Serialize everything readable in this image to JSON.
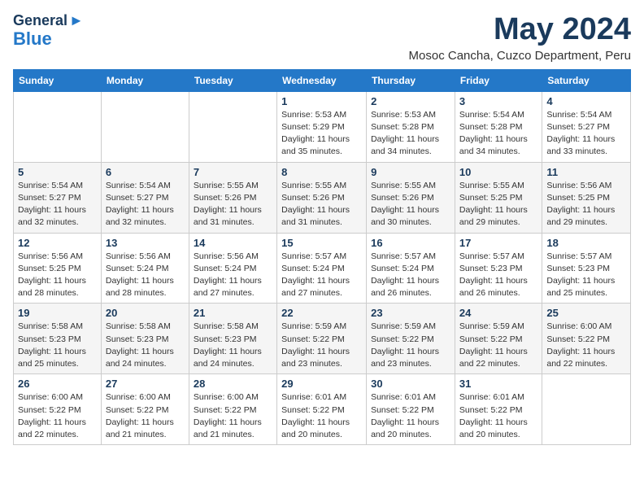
{
  "header": {
    "logo_line1": "General",
    "logo_line2": "Blue",
    "month": "May 2024",
    "location": "Mosoc Cancha, Cuzco Department, Peru"
  },
  "weekdays": [
    "Sunday",
    "Monday",
    "Tuesday",
    "Wednesday",
    "Thursday",
    "Friday",
    "Saturday"
  ],
  "weeks": [
    [
      {
        "day": "",
        "detail": ""
      },
      {
        "day": "",
        "detail": ""
      },
      {
        "day": "",
        "detail": ""
      },
      {
        "day": "1",
        "detail": "Sunrise: 5:53 AM\nSunset: 5:29 PM\nDaylight: 11 hours\nand 35 minutes."
      },
      {
        "day": "2",
        "detail": "Sunrise: 5:53 AM\nSunset: 5:28 PM\nDaylight: 11 hours\nand 34 minutes."
      },
      {
        "day": "3",
        "detail": "Sunrise: 5:54 AM\nSunset: 5:28 PM\nDaylight: 11 hours\nand 34 minutes."
      },
      {
        "day": "4",
        "detail": "Sunrise: 5:54 AM\nSunset: 5:27 PM\nDaylight: 11 hours\nand 33 minutes."
      }
    ],
    [
      {
        "day": "5",
        "detail": "Sunrise: 5:54 AM\nSunset: 5:27 PM\nDaylight: 11 hours\nand 32 minutes."
      },
      {
        "day": "6",
        "detail": "Sunrise: 5:54 AM\nSunset: 5:27 PM\nDaylight: 11 hours\nand 32 minutes."
      },
      {
        "day": "7",
        "detail": "Sunrise: 5:55 AM\nSunset: 5:26 PM\nDaylight: 11 hours\nand 31 minutes."
      },
      {
        "day": "8",
        "detail": "Sunrise: 5:55 AM\nSunset: 5:26 PM\nDaylight: 11 hours\nand 31 minutes."
      },
      {
        "day": "9",
        "detail": "Sunrise: 5:55 AM\nSunset: 5:26 PM\nDaylight: 11 hours\nand 30 minutes."
      },
      {
        "day": "10",
        "detail": "Sunrise: 5:55 AM\nSunset: 5:25 PM\nDaylight: 11 hours\nand 29 minutes."
      },
      {
        "day": "11",
        "detail": "Sunrise: 5:56 AM\nSunset: 5:25 PM\nDaylight: 11 hours\nand 29 minutes."
      }
    ],
    [
      {
        "day": "12",
        "detail": "Sunrise: 5:56 AM\nSunset: 5:25 PM\nDaylight: 11 hours\nand 28 minutes."
      },
      {
        "day": "13",
        "detail": "Sunrise: 5:56 AM\nSunset: 5:24 PM\nDaylight: 11 hours\nand 28 minutes."
      },
      {
        "day": "14",
        "detail": "Sunrise: 5:56 AM\nSunset: 5:24 PM\nDaylight: 11 hours\nand 27 minutes."
      },
      {
        "day": "15",
        "detail": "Sunrise: 5:57 AM\nSunset: 5:24 PM\nDaylight: 11 hours\nand 27 minutes."
      },
      {
        "day": "16",
        "detail": "Sunrise: 5:57 AM\nSunset: 5:24 PM\nDaylight: 11 hours\nand 26 minutes."
      },
      {
        "day": "17",
        "detail": "Sunrise: 5:57 AM\nSunset: 5:23 PM\nDaylight: 11 hours\nand 26 minutes."
      },
      {
        "day": "18",
        "detail": "Sunrise: 5:57 AM\nSunset: 5:23 PM\nDaylight: 11 hours\nand 25 minutes."
      }
    ],
    [
      {
        "day": "19",
        "detail": "Sunrise: 5:58 AM\nSunset: 5:23 PM\nDaylight: 11 hours\nand 25 minutes."
      },
      {
        "day": "20",
        "detail": "Sunrise: 5:58 AM\nSunset: 5:23 PM\nDaylight: 11 hours\nand 24 minutes."
      },
      {
        "day": "21",
        "detail": "Sunrise: 5:58 AM\nSunset: 5:23 PM\nDaylight: 11 hours\nand 24 minutes."
      },
      {
        "day": "22",
        "detail": "Sunrise: 5:59 AM\nSunset: 5:22 PM\nDaylight: 11 hours\nand 23 minutes."
      },
      {
        "day": "23",
        "detail": "Sunrise: 5:59 AM\nSunset: 5:22 PM\nDaylight: 11 hours\nand 23 minutes."
      },
      {
        "day": "24",
        "detail": "Sunrise: 5:59 AM\nSunset: 5:22 PM\nDaylight: 11 hours\nand 22 minutes."
      },
      {
        "day": "25",
        "detail": "Sunrise: 6:00 AM\nSunset: 5:22 PM\nDaylight: 11 hours\nand 22 minutes."
      }
    ],
    [
      {
        "day": "26",
        "detail": "Sunrise: 6:00 AM\nSunset: 5:22 PM\nDaylight: 11 hours\nand 22 minutes."
      },
      {
        "day": "27",
        "detail": "Sunrise: 6:00 AM\nSunset: 5:22 PM\nDaylight: 11 hours\nand 21 minutes."
      },
      {
        "day": "28",
        "detail": "Sunrise: 6:00 AM\nSunset: 5:22 PM\nDaylight: 11 hours\nand 21 minutes."
      },
      {
        "day": "29",
        "detail": "Sunrise: 6:01 AM\nSunset: 5:22 PM\nDaylight: 11 hours\nand 20 minutes."
      },
      {
        "day": "30",
        "detail": "Sunrise: 6:01 AM\nSunset: 5:22 PM\nDaylight: 11 hours\nand 20 minutes."
      },
      {
        "day": "31",
        "detail": "Sunrise: 6:01 AM\nSunset: 5:22 PM\nDaylight: 11 hours\nand 20 minutes."
      },
      {
        "day": "",
        "detail": ""
      }
    ]
  ]
}
